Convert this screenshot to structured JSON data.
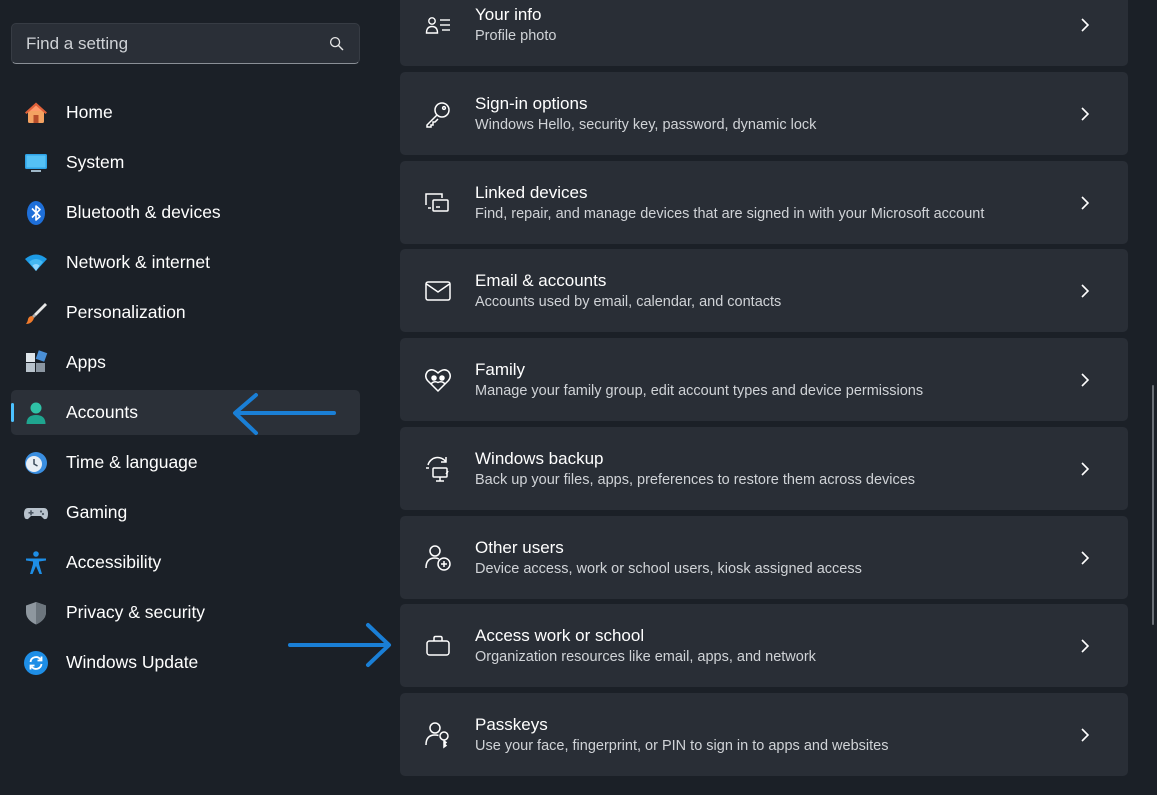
{
  "search": {
    "placeholder": "Find a setting",
    "icon": "search-icon"
  },
  "sidebar": {
    "items": [
      {
        "label": "Home",
        "icon": "home-icon"
      },
      {
        "label": "System",
        "icon": "system-icon"
      },
      {
        "label": "Bluetooth & devices",
        "icon": "bluetooth-icon"
      },
      {
        "label": "Network & internet",
        "icon": "wifi-icon"
      },
      {
        "label": "Personalization",
        "icon": "brush-icon"
      },
      {
        "label": "Apps",
        "icon": "apps-icon"
      },
      {
        "label": "Accounts",
        "icon": "account-icon",
        "selected": true
      },
      {
        "label": "Time & language",
        "icon": "clock-globe-icon"
      },
      {
        "label": "Gaming",
        "icon": "gamepad-icon"
      },
      {
        "label": "Accessibility",
        "icon": "accessibility-icon"
      },
      {
        "label": "Privacy & security",
        "icon": "shield-icon"
      },
      {
        "label": "Windows Update",
        "icon": "update-icon"
      }
    ]
  },
  "main": {
    "cards": [
      {
        "title": "Your info",
        "subtitle": "Profile photo",
        "icon": "user-info-icon"
      },
      {
        "title": "Sign-in options",
        "subtitle": "Windows Hello, security key, password, dynamic lock",
        "icon": "key-icon"
      },
      {
        "title": "Linked devices",
        "subtitle": "Find, repair, and manage devices that are signed in with your Microsoft account",
        "icon": "linked-devices-icon"
      },
      {
        "title": "Email & accounts",
        "subtitle": "Accounts used by email, calendar, and contacts",
        "icon": "mail-icon"
      },
      {
        "title": "Family",
        "subtitle": "Manage your family group, edit account types and device permissions",
        "icon": "family-heart-icon"
      },
      {
        "title": "Windows backup",
        "subtitle": "Back up your files, apps, preferences to restore them across devices",
        "icon": "backup-icon"
      },
      {
        "title": "Other users",
        "subtitle": "Device access, work or school users, kiosk assigned access",
        "icon": "add-user-icon"
      },
      {
        "title": "Access work or school",
        "subtitle": "Organization resources like email, apps, and network",
        "icon": "briefcase-icon"
      },
      {
        "title": "Passkeys",
        "subtitle": "Use your face, fingerprint, or PIN to sign in to apps and websites",
        "icon": "passkey-icon"
      }
    ]
  },
  "colors": {
    "accent": "#4cc2ff",
    "annotation_arrow": "#1a7fd6",
    "background": "#1b2027",
    "card": "#292e36"
  }
}
